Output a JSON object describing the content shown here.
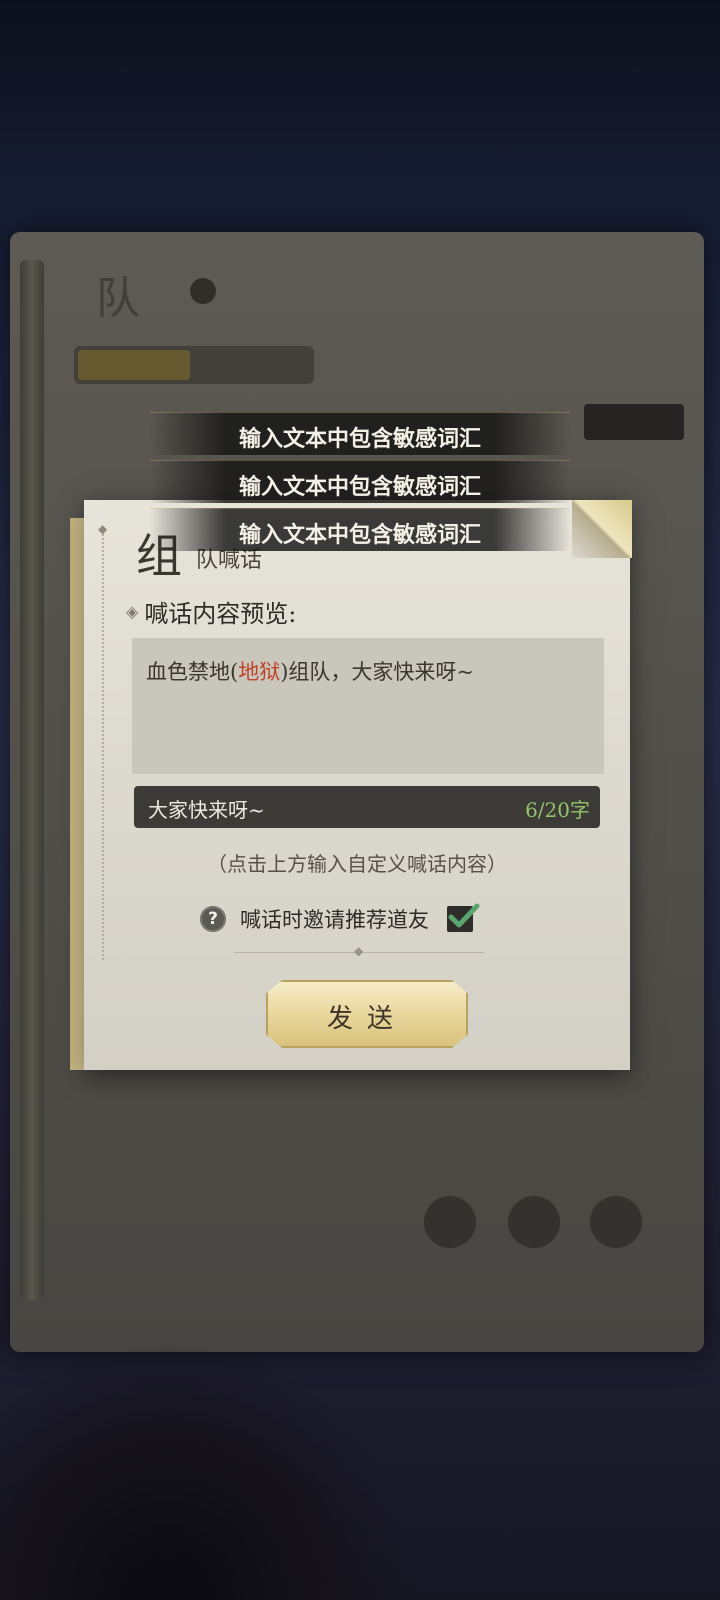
{
  "dialog": {
    "title_big": "组",
    "title_small": "队喊话",
    "section_label": "喊话内容预览:",
    "preview": {
      "prefix": "血色禁地(",
      "highlight": "地狱",
      "suffix": ")组队，大家快来呀~"
    },
    "input": {
      "value": "大家快来呀~",
      "count": "6/20字"
    },
    "hint": "（点击上方输入自定义喊话内容）",
    "invite_label": "喊话时邀请推荐道友",
    "help_symbol": "?",
    "send_label": "发送"
  },
  "toasts": [
    "输入文本中包含敏感词汇",
    "输入文本中包含敏感词汇",
    "输入文本中包含敏感词汇"
  ],
  "colors": {
    "highlight": "#c0432a",
    "count": "#94c46a",
    "check": "#5aa46e"
  },
  "icons": {
    "help": "question-circle-icon",
    "check": "checkmark-icon"
  }
}
